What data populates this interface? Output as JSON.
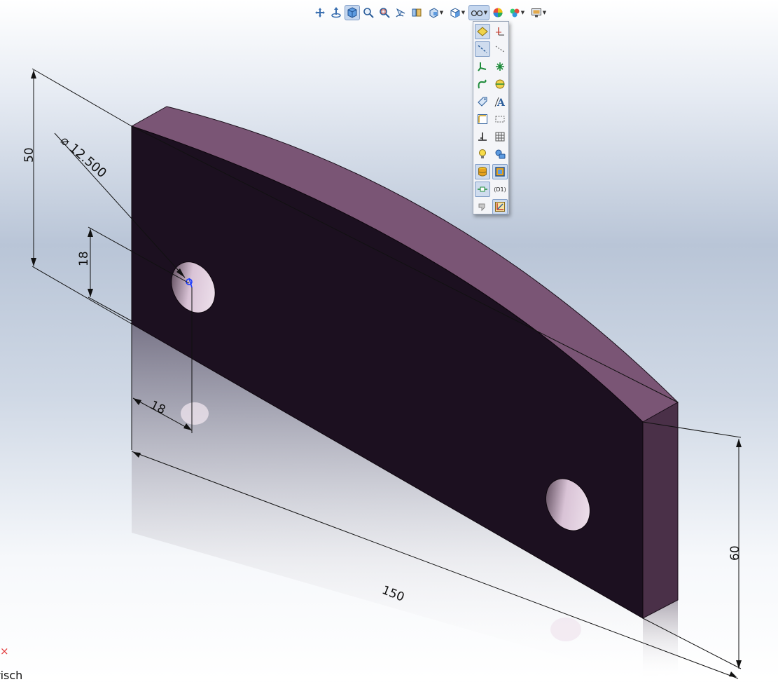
{
  "toolbar": {
    "buttons": [
      {
        "name": "pan-icon",
        "tooltip": ""
      },
      {
        "name": "normal-to-icon",
        "tooltip": ""
      },
      {
        "name": "3d-view-icon",
        "tooltip": ""
      },
      {
        "name": "zoom-to-fit-icon",
        "tooltip": ""
      },
      {
        "name": "zoom-to-area-icon",
        "tooltip": ""
      },
      {
        "name": "previous-view-icon",
        "tooltip": ""
      },
      {
        "name": "section-view-icon",
        "tooltip": ""
      },
      {
        "name": "view-orientation-icon",
        "tooltip": ""
      },
      {
        "name": "display-style-icon",
        "tooltip": ""
      },
      {
        "name": "hide-show-items-icon",
        "tooltip": ""
      },
      {
        "name": "edit-appearance-icon",
        "tooltip": ""
      },
      {
        "name": "apply-scene-icon",
        "tooltip": ""
      },
      {
        "name": "view-settings-icon",
        "tooltip": ""
      }
    ]
  },
  "flyout": {
    "text_item": "(D1)"
  },
  "model": {
    "face_color": "#1c1020",
    "top_color": "#7a5575",
    "side_color": "#4a3048",
    "hole_color": "#e8d9e6"
  },
  "dimensions": {
    "height_left": "50",
    "hole_diameter": "12.500",
    "diameter_symbol": "⌀",
    "hole_height": "18",
    "hole_offset": "18",
    "length": "150",
    "height_right": "60"
  },
  "status": {
    "close_symbol": "×",
    "text": "risch"
  }
}
